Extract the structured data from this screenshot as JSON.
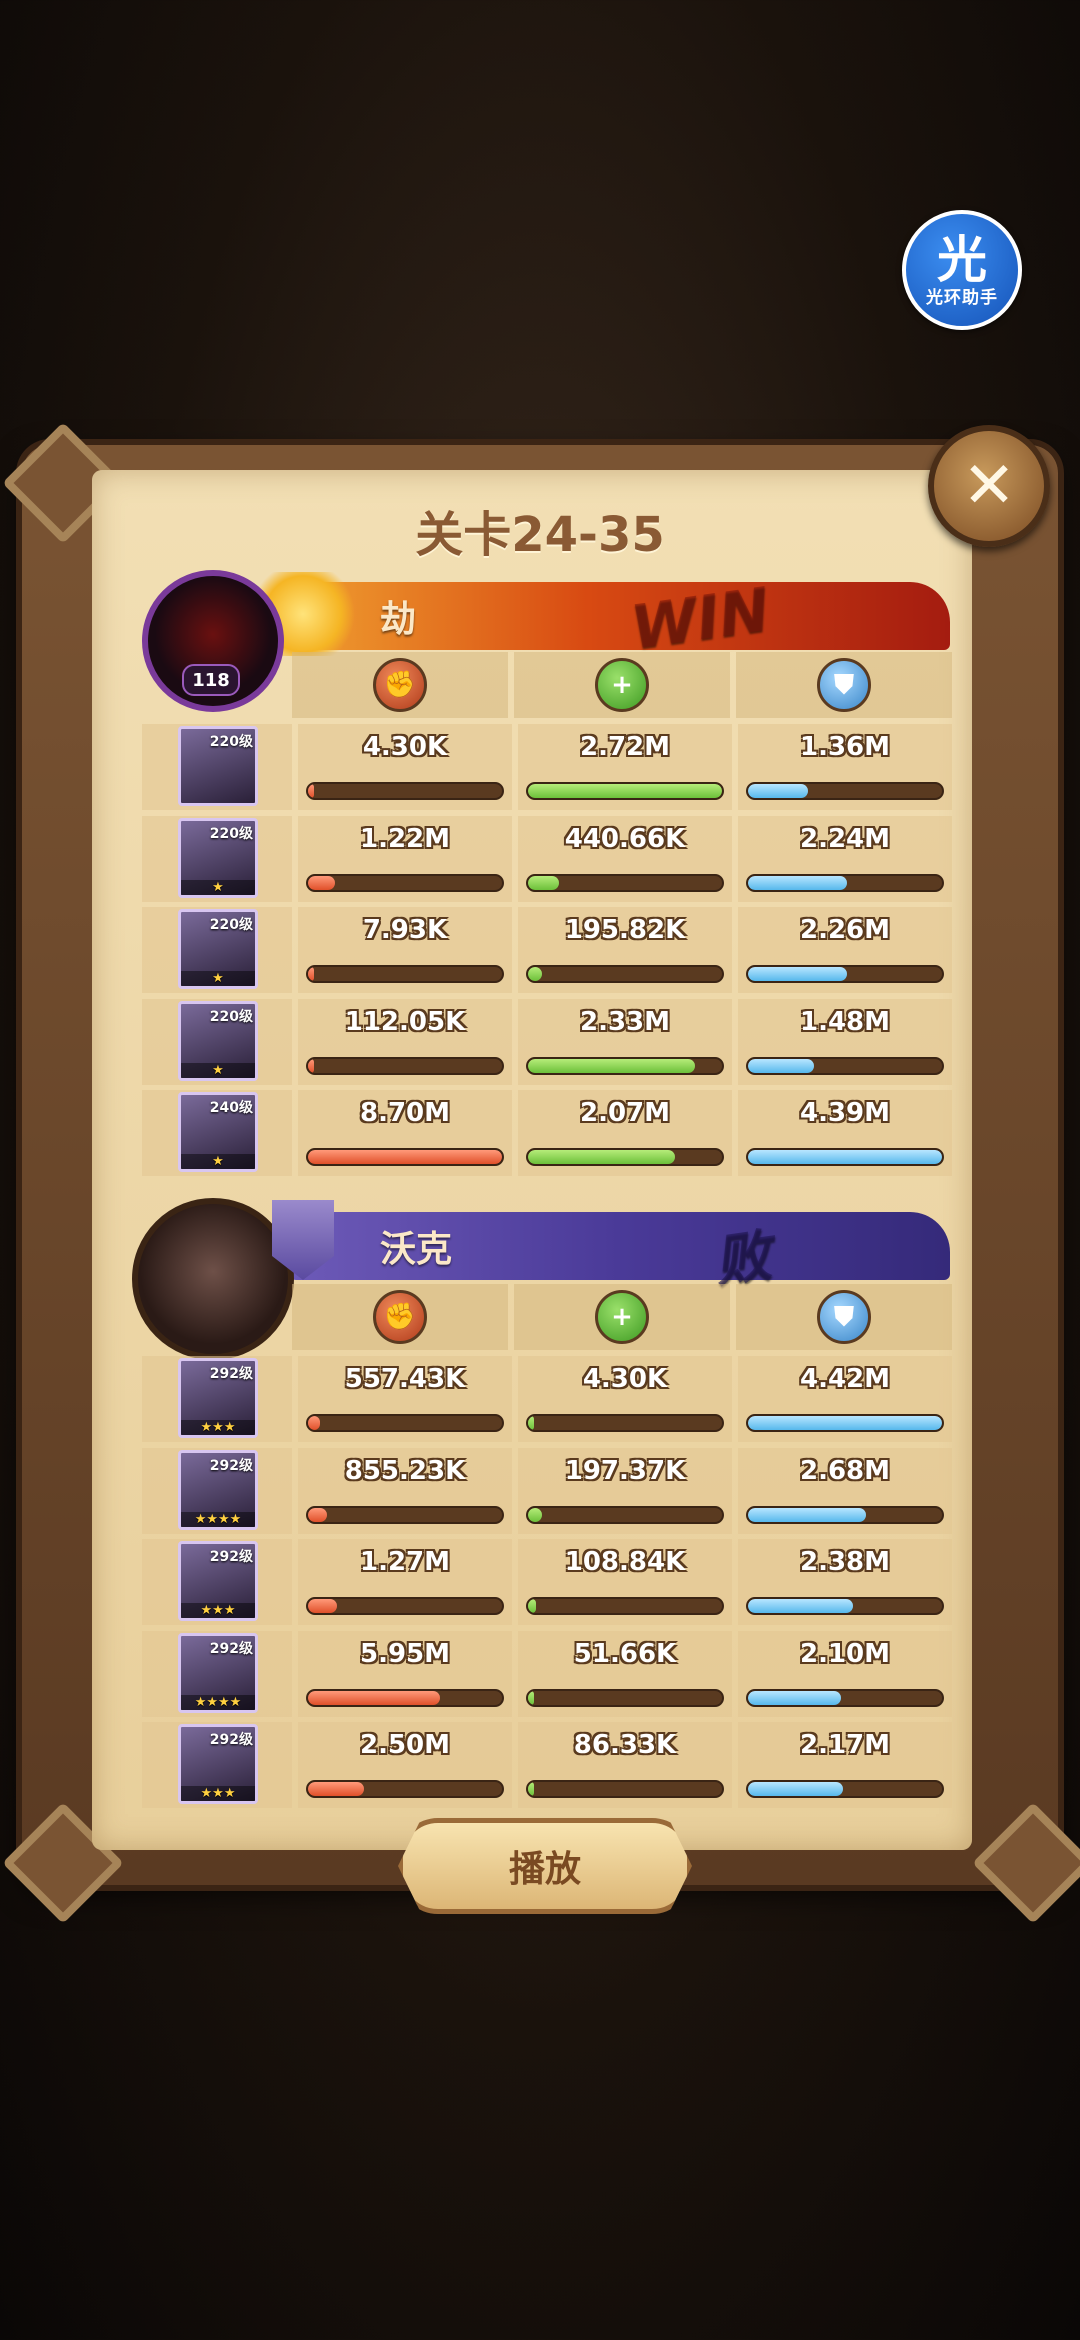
{
  "assistant": {
    "glyph": "光",
    "name": "光环助手"
  },
  "stage_title": "关卡24-35",
  "winner": {
    "name": "劫",
    "result": "WIN",
    "leader_level": "118",
    "heroes": [
      {
        "level": "220级",
        "stars": "",
        "damage": "4.30K",
        "heal": "2.72M",
        "shield": "1.36M",
        "damage_pct": 0.01,
        "heal_pct": 1.0,
        "shield_pct": 0.31
      },
      {
        "level": "220级",
        "stars": "★",
        "damage": "1.22M",
        "heal": "440.66K",
        "shield": "2.24M",
        "damage_pct": 0.14,
        "heal_pct": 0.16,
        "shield_pct": 0.51
      },
      {
        "level": "220级",
        "stars": "★",
        "damage": "7.93K",
        "heal": "195.82K",
        "shield": "2.26M",
        "damage_pct": 0.01,
        "heal_pct": 0.07,
        "shield_pct": 0.51
      },
      {
        "level": "220级",
        "stars": "★",
        "damage": "112.05K",
        "heal": "2.33M",
        "shield": "1.48M",
        "damage_pct": 0.01,
        "heal_pct": 0.86,
        "shield_pct": 0.34
      },
      {
        "level": "240级",
        "stars": "★",
        "damage": "8.70M",
        "heal": "2.07M",
        "shield": "4.39M",
        "damage_pct": 1.0,
        "heal_pct": 0.76,
        "shield_pct": 1.0
      }
    ]
  },
  "loser": {
    "name": "沃克",
    "result": "败",
    "heroes": [
      {
        "level": "292级",
        "stars": "★★★",
        "damage": "557.43K",
        "heal": "4.30K",
        "shield": "4.42M",
        "damage_pct": 0.06,
        "heal_pct": 0.01,
        "shield_pct": 1.0
      },
      {
        "level": "292级",
        "stars": "★★★★",
        "damage": "855.23K",
        "heal": "197.37K",
        "shield": "2.68M",
        "damage_pct": 0.1,
        "heal_pct": 0.07,
        "shield_pct": 0.61
      },
      {
        "level": "292级",
        "stars": "★★★",
        "damage": "1.27M",
        "heal": "108.84K",
        "shield": "2.38M",
        "damage_pct": 0.15,
        "heal_pct": 0.04,
        "shield_pct": 0.54
      },
      {
        "level": "292级",
        "stars": "★★★★",
        "damage": "5.95M",
        "heal": "51.66K",
        "shield": "2.10M",
        "damage_pct": 0.68,
        "heal_pct": 0.02,
        "shield_pct": 0.48
      },
      {
        "level": "292级",
        "stars": "★★★",
        "damage": "2.50M",
        "heal": "86.33K",
        "shield": "2.17M",
        "damage_pct": 0.29,
        "heal_pct": 0.03,
        "shield_pct": 0.49
      }
    ]
  },
  "icons": {
    "damage": "fist-icon",
    "heal": "heal-plus-icon",
    "shield": "shield-icon",
    "close": "close-icon"
  },
  "play_label": "播放"
}
